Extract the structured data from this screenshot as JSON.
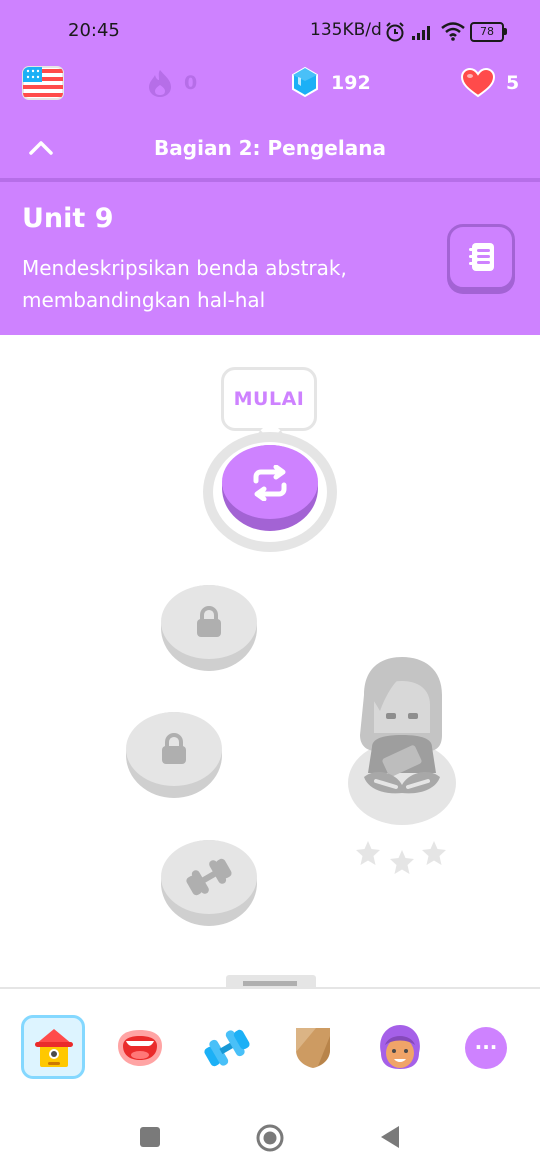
{
  "status_bar": {
    "time": "20:45",
    "network_speed": "135KB/d",
    "battery": "78"
  },
  "top_bar": {
    "flag_icon": "us-flag-icon",
    "streak_count": "0",
    "gems_count": "192",
    "hearts_count": "5"
  },
  "section": {
    "title": "Bagian 2: Pengelana"
  },
  "unit": {
    "title": "Unit 9",
    "description": "Mendeskripsikan benda abstrak, membandingkan hal-hal"
  },
  "path": {
    "start_label": "MULAI"
  },
  "bottom_nav": {
    "items": [
      "home-icon",
      "speaking-icon",
      "practice-icon",
      "leagues-icon",
      "profile-icon",
      "more-icon"
    ],
    "more_label": "···"
  },
  "colors": {
    "accent": "#ce82ff",
    "accent_dark": "#a363d4",
    "locked": "#e5e5e5",
    "locked_dark": "#cfcfcf",
    "heart": "#ff4b4b",
    "gem": "#1cb0f6"
  }
}
